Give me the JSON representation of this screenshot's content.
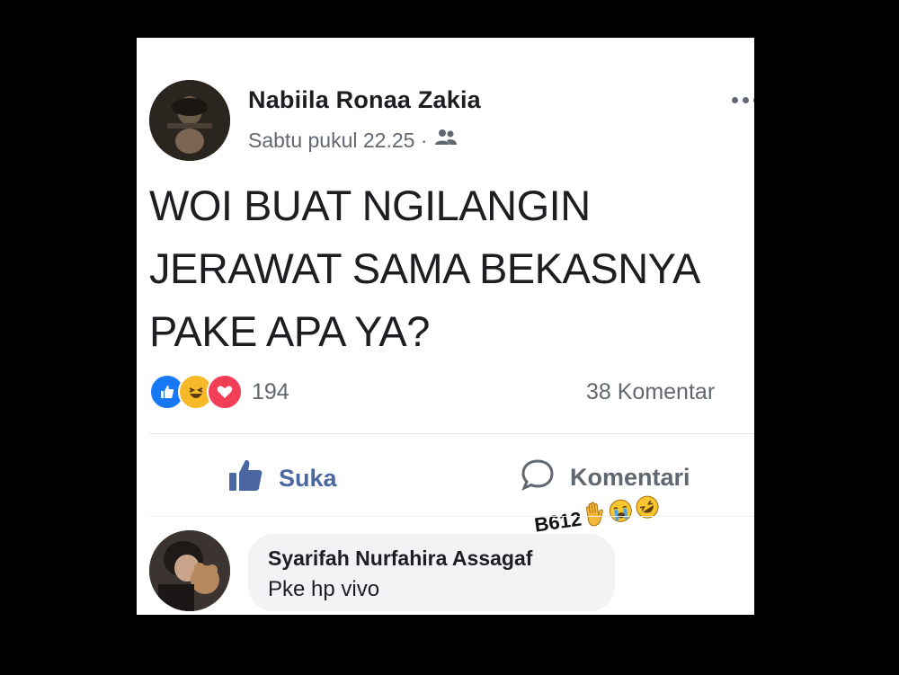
{
  "post": {
    "author": "Nabiila Ronaa Zakia",
    "time": "Sabtu pukul 22.25 ·",
    "audience_icon": "friends-icon",
    "text": "WOI BUAT NGILANGIN\nJERAWAT SAMA BEKASNYA\nPAKE APA YA?",
    "reactions": [
      "like",
      "haha",
      "love"
    ],
    "reaction_count": "194",
    "comment_count": "38 Komentar"
  },
  "actions": {
    "like_label": "Suka",
    "comment_label": "Komentari"
  },
  "watermark": {
    "text": "B612"
  },
  "comment": {
    "author": "Syarifah Nurfahira Assagaf",
    "text": "Pke hp vivo"
  },
  "colors": {
    "like_blue": "#1877f2",
    "love_red": "#f33e58",
    "haha_yellow": "#f7b928",
    "text_gray": "#606770"
  }
}
